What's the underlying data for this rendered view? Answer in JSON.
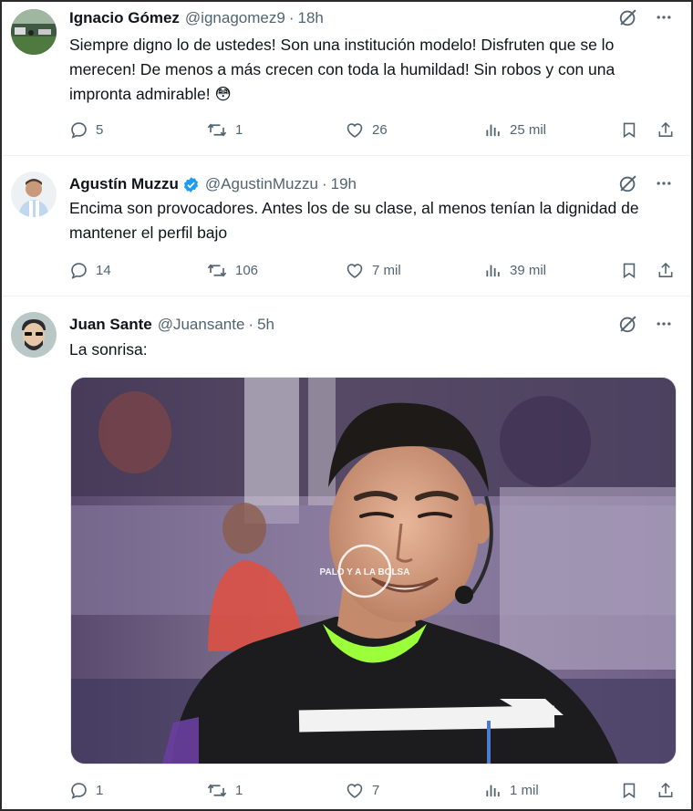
{
  "tweets": [
    {
      "name": "Ignacio Gómez",
      "handle": "@ignagomez9",
      "sep": "·",
      "time": "18h",
      "text": "Siempre digno lo de ustedes! Son una institución modelo! Disfruten que se lo merecen! De menos a más crecen con toda la humildad! Sin robos y con una impronta admirable! 😳",
      "replies": "5",
      "reposts": "1",
      "likes": "26",
      "views": "25 mil"
    },
    {
      "name": "Agustín Muzzu",
      "handle": "@AgustinMuzzu",
      "sep": "·",
      "time": "19h",
      "verified": true,
      "text": "Encima son provocadores. Antes los de su clase, al menos tenían la dignidad de mantener el perfil bajo",
      "replies": "14",
      "reposts": "106",
      "likes": "7 mil",
      "views": "39 mil"
    },
    {
      "name": "Juan Sante",
      "handle": "@Juansante",
      "sep": "·",
      "time": "5h",
      "text": "La sonrisa:",
      "media_watermark": "PALO Y A LA BOLSA",
      "replies": "1",
      "reposts": "1",
      "likes": "7",
      "views": "1 mil"
    }
  ],
  "icons": {
    "grok": "grok-icon",
    "more": "more-icon",
    "reply": "reply-icon",
    "repost": "repost-icon",
    "like": "like-icon",
    "views": "views-icon",
    "bookmark": "bookmark-icon",
    "share": "share-icon",
    "verified": "verified-badge-icon"
  },
  "colors": {
    "text": "#0f1419",
    "muted": "#536471",
    "verified": "#1d9bf0"
  }
}
